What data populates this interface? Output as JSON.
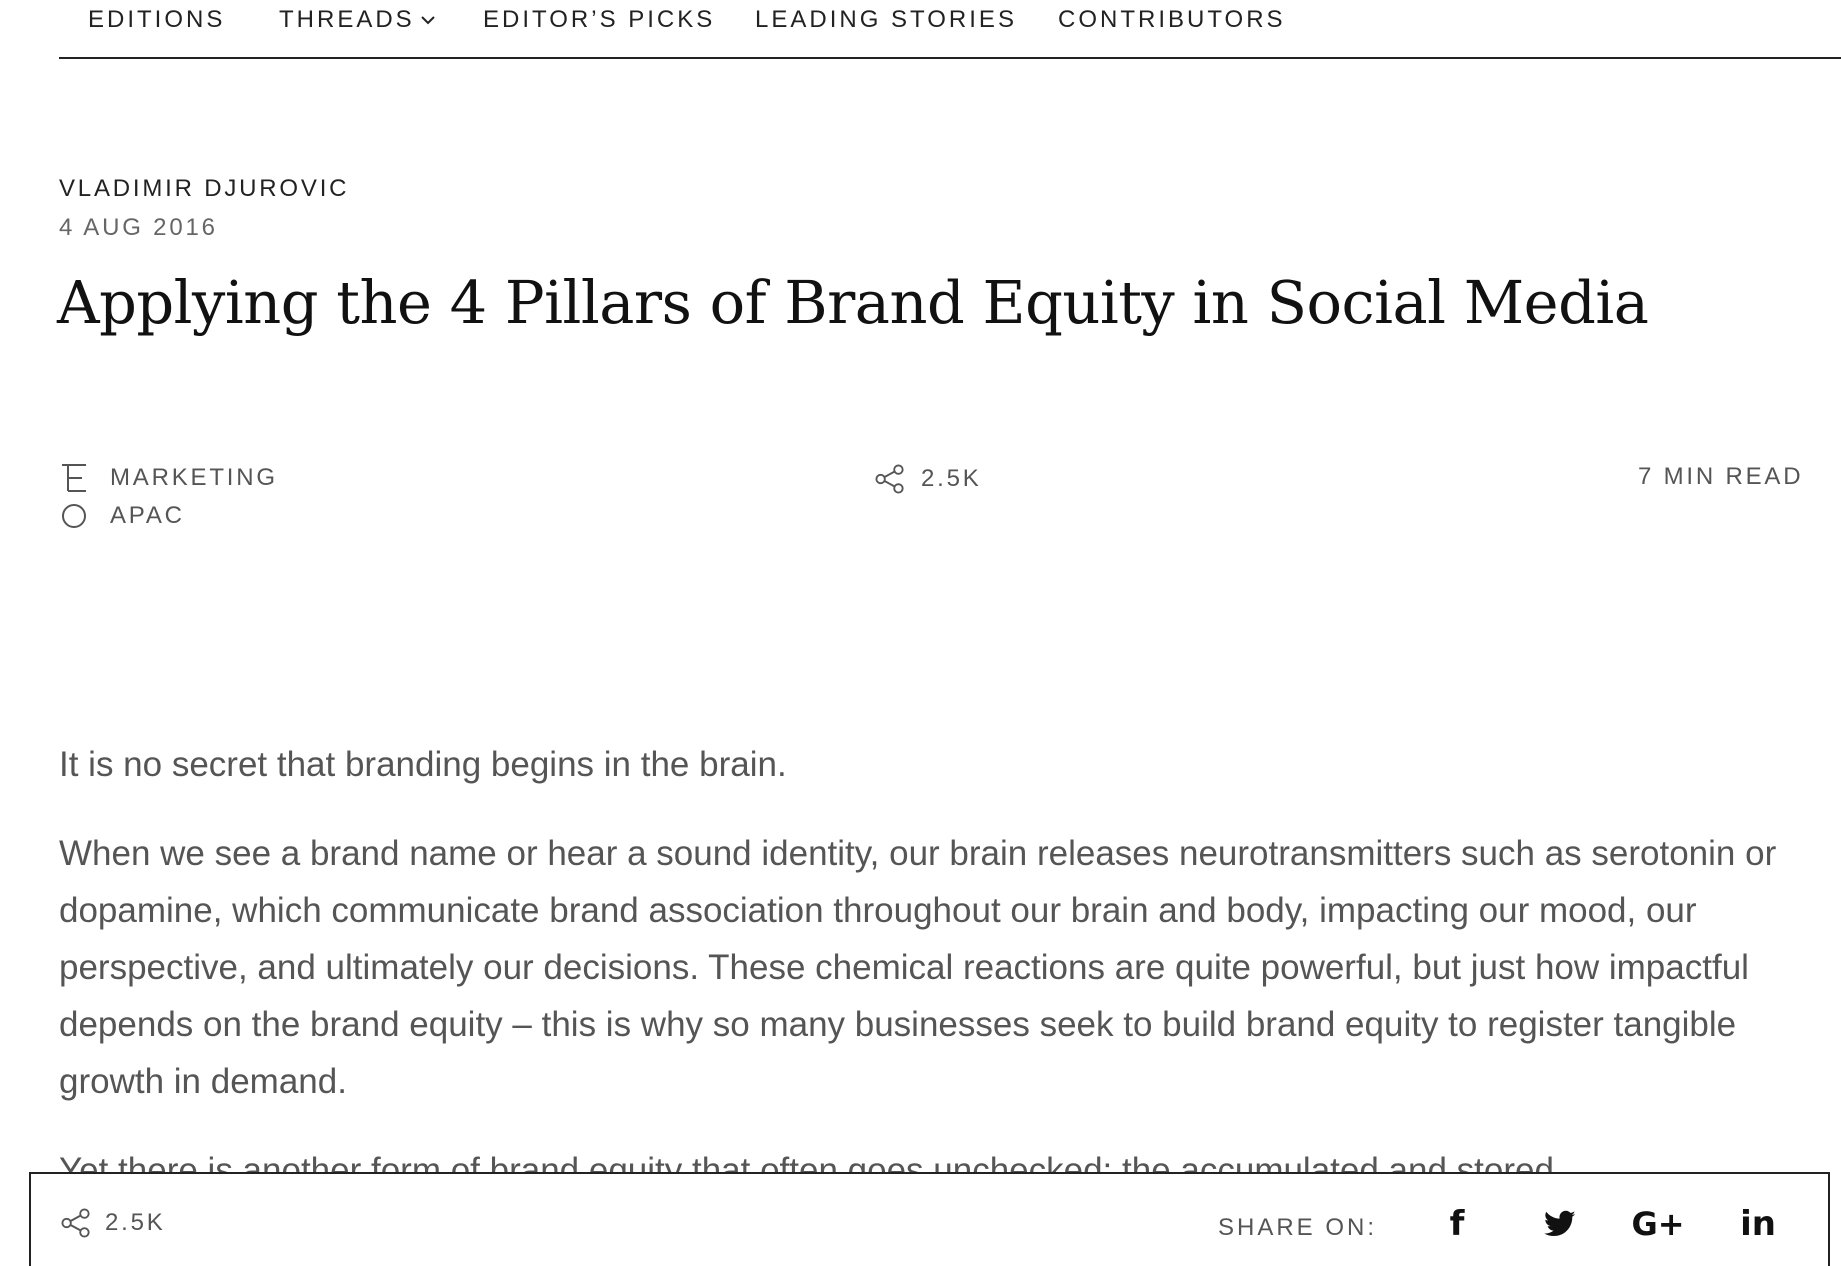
{
  "nav": {
    "items": [
      {
        "label": "EDITIONS"
      },
      {
        "label": "THREADS"
      },
      {
        "label": "EDITOR’S PICKS"
      },
      {
        "label": "LEADING STORIES"
      },
      {
        "label": "CONTRIBUTORS"
      }
    ]
  },
  "article": {
    "author": "VLADIMIR DJUROVIC",
    "date": "4 AUG 2016",
    "title": "Applying the 4 Pillars of Brand Equity in Social Media",
    "category": "MARKETING",
    "region": "APAC",
    "shares": "2.5K",
    "read_time": "7 MIN READ",
    "paragraphs": [
      "It is no secret that branding begins in the brain.",
      "When we see a brand name or hear a sound identity, our brain releases neurotransmitters such as serotonin or dopamine, which communicate brand association throughout our brain and body, impacting our mood, our perspective, and ultimately our decisions. These chemical reactions are quite powerful, but just how impactful depends on the brand equity – this is why so many businesses seek to build brand equity to register tangible growth in demand.",
      "Yet there is another form of brand equity that often goes unchecked: the accumulated and stored"
    ]
  },
  "sharebar": {
    "count": "2.5K",
    "label": "SHARE ON:",
    "facebook": "f",
    "googleplus": "G+",
    "linkedin": "in"
  },
  "icons": {
    "category": "category-icon",
    "region": "circle-icon",
    "share": "share-icon",
    "threads_dropdown": "chevron-down-icon",
    "twitter": "twitter-icon"
  },
  "colors": {
    "text_dark": "#222222",
    "text_muted": "#555555",
    "border": "#222222",
    "background": "#ffffff"
  }
}
